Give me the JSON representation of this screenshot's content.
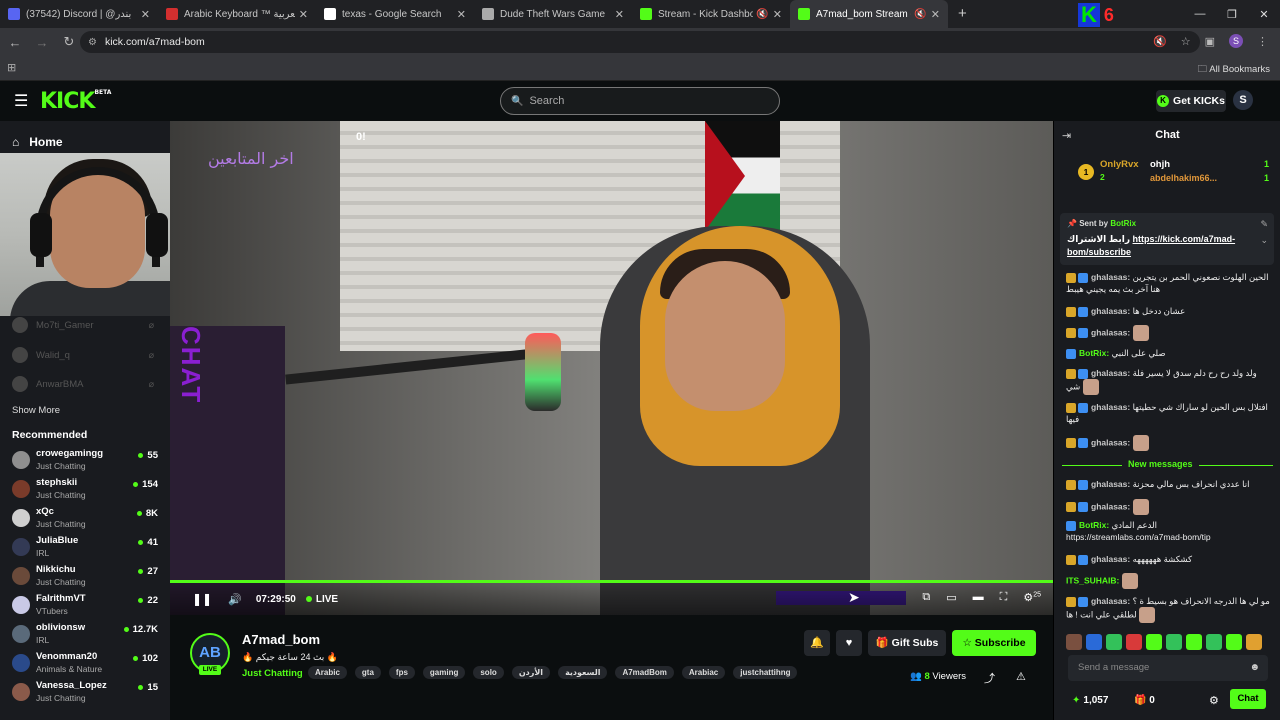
{
  "browser": {
    "tabs": [
      {
        "label": "(37542) Discord | @بندر",
        "color": "#5865f2",
        "active": false,
        "muted": false
      },
      {
        "label": "Arabic Keyboard ™ لوحة المفاتيح العربية",
        "color": "#d32f2f",
        "active": false,
        "muted": false
      },
      {
        "label": "texas - Google Search",
        "color": "#ffffff",
        "active": false,
        "muted": false
      },
      {
        "label": "Dude Theft Wars Game",
        "color": "#aaaaaa",
        "active": false,
        "muted": false
      },
      {
        "label": "Stream - Kick Dashboard",
        "color": "#53fc18",
        "active": false,
        "muted": true
      },
      {
        "label": "A7mad_bom Stream - Watc",
        "color": "#53fc18",
        "active": true,
        "muted": true
      }
    ],
    "url": "kick.com/a7mad-bom",
    "bookmarks_label": "All Bookmarks",
    "logo_letter": "K",
    "logo_number": "6"
  },
  "header": {
    "logo": "KICK",
    "logo_sup": "BETA",
    "search_placeholder": "Search",
    "get_kicks": "Get KICKs",
    "user_initial": "S"
  },
  "sidebar": {
    "home": "Home",
    "followed": [
      {
        "name": "Mo7ti_Gamer"
      },
      {
        "name": "Walid_q"
      },
      {
        "name": "AnwarBMA"
      }
    ],
    "show_more": "Show More",
    "recommended_title": "Recommended",
    "recommended": [
      {
        "name": "crowegamingg",
        "category": "Just Chatting",
        "viewers": "55",
        "color": "#8f8f8f"
      },
      {
        "name": "stephskii",
        "category": "Just Chatting",
        "viewers": "154",
        "color": "#7a3b2a"
      },
      {
        "name": "xQc",
        "category": "Just Chatting",
        "viewers": "8K",
        "color": "#cfcfcf"
      },
      {
        "name": "JuliaBlue",
        "category": "IRL",
        "viewers": "41",
        "color": "#333a55"
      },
      {
        "name": "Nikkichu",
        "category": "Just Chatting",
        "viewers": "27",
        "color": "#6a4a3a"
      },
      {
        "name": "FalrithmVT",
        "category": "VTubers",
        "viewers": "22",
        "color": "#c9c9e6"
      },
      {
        "name": "oblivionsw",
        "category": "IRL",
        "viewers": "12.7K",
        "color": "#5a6a7a"
      },
      {
        "name": "Venomman20",
        "category": "Animals & Nature",
        "viewers": "102",
        "color": "#2a4a8a"
      },
      {
        "name": "Vanessa_Lopez",
        "category": "Just Chatting",
        "viewers": "15",
        "color": "#8a5a4a"
      }
    ]
  },
  "video": {
    "overlay_text": "اخر المتابعين",
    "overlay_text2": "0!",
    "side_word": "CHAT",
    "time": "07:29:50",
    "live": "LIVE",
    "quality_badge": "25"
  },
  "channel": {
    "avatar_text": "AB",
    "live_badge": "LIVE",
    "name": "A7mad_bom",
    "title": "🔥 بث 24 ساعة جيكم 🔥",
    "category": "Just Chatting",
    "tags": [
      "Arabic",
      "gta",
      "fps",
      "gaming",
      "solo",
      "الأردن",
      "السعودية",
      "A7madBom",
      "Arabiac",
      "justchattihng"
    ],
    "gift_subs": "Gift Subs",
    "subscribe": "Subscribe",
    "viewers_count": "8",
    "viewers_label": "Viewers"
  },
  "chat": {
    "title": "Chat",
    "leaderboard": {
      "rank": "1",
      "left_name": "OnlyRvx",
      "left_count": "2",
      "right_name1": "ohjh",
      "right_name2": "abdelhakim66...",
      "count1": "1",
      "count2": "1"
    },
    "pinned": {
      "sent_by_label": "Sent by",
      "sender": "BotRix",
      "text": "رابط الاشتراك",
      "link": "https://kick.com/a7mad-bom/subscribe"
    },
    "messages": [
      {
        "user": "ghalasas:",
        "text": "الحين الهلوت نصعوني الحمر بن يتجرين هنا آخر بث يمه يجيني هيبط",
        "emote": false,
        "bot": false
      },
      {
        "user": "ghalasas:",
        "text": "عشان ددخل ها",
        "emote": false,
        "bot": false
      },
      {
        "user": "ghalasas:",
        "text": "",
        "emote": true,
        "bot": false
      },
      {
        "user": "BotRix:",
        "text": "صلي على النبي",
        "emote": false,
        "bot": true
      },
      {
        "user": "ghalasas:",
        "text": "ولد ولد رح رح دلم سدق لا يسير فلة شي",
        "emote": true,
        "bot": false
      },
      {
        "user": "ghalasas:",
        "text": "افتلال بس الحين لو ساراك شي حطيتها فيها",
        "emote": false,
        "bot": false
      },
      {
        "user": "ghalasas:",
        "text": "",
        "emote": true,
        "bot": false
      }
    ],
    "new_messages_label": "New messages",
    "messages2": [
      {
        "user": "ghalasas:",
        "text": "انا عددي انحراف بس مالي محزنة",
        "emote": false,
        "bot": false
      },
      {
        "user": "ghalasas:",
        "text": "",
        "emote": true,
        "bot": false
      },
      {
        "user": "BotRix:",
        "text": "الدعم المادي https://streamlabs.com/a7mad-bom/tip",
        "emote": false,
        "bot": true
      },
      {
        "user": "ghalasas:",
        "text": "كشكشة ههههههه",
        "emote": false,
        "bot": false
      },
      {
        "user": "ITS_SUHAIB:",
        "text": "",
        "emote": true,
        "bot": false,
        "green": true
      },
      {
        "user": "ghalasas:",
        "text": "مو لي ها الدرجه الانحراف هو بسيط ة ؟ لطلقي علي انت ! ها",
        "emote": true,
        "bot": false
      }
    ],
    "send_placeholder": "Send a message",
    "points": "1,057",
    "gifts": "0",
    "chat_button": "Chat"
  }
}
